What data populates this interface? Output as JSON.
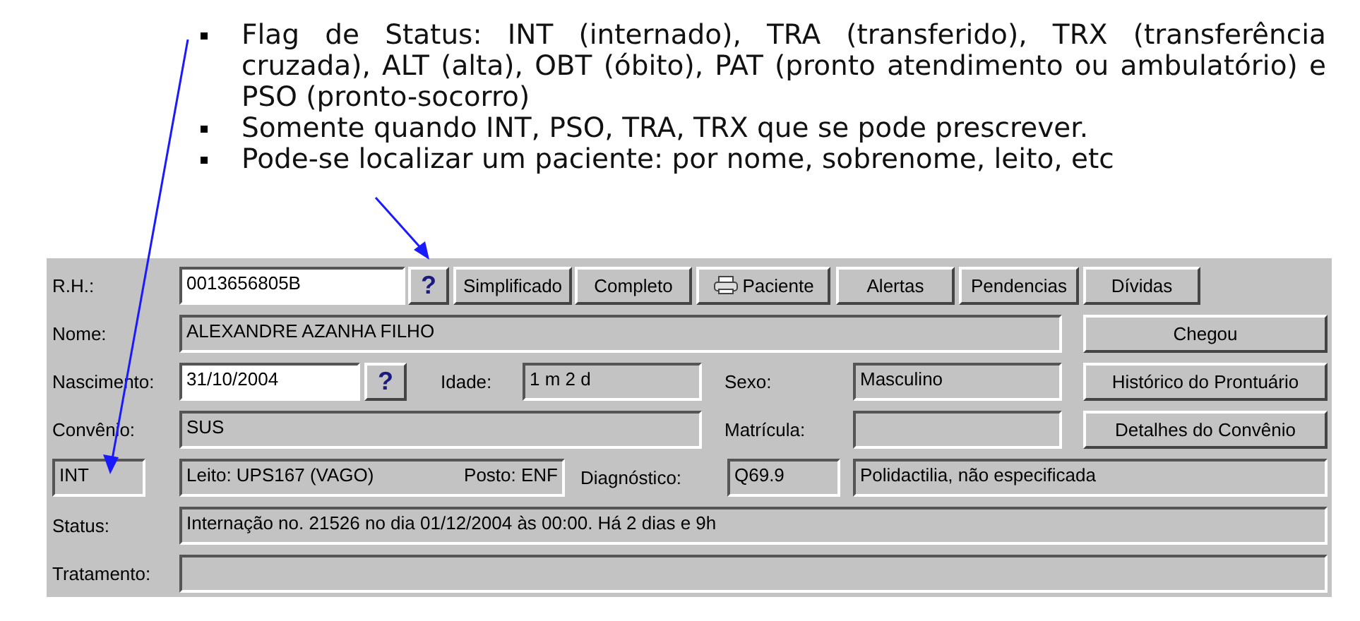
{
  "bullets": [
    "Flag de Status: INT (internado), TRA (transferido), TRX (transferência cruzada), ALT (alta), OBT (óbito), PAT (pronto atendimento ou ambulatório) e PSO (pronto-socorro)",
    "Somente quando INT, PSO, TRA, TRX que se pode prescrever.",
    "Pode-se localizar um paciente: por nome, sobrenome, leito, etc"
  ],
  "form": {
    "rows": [
      {
        "items": [
          {
            "kind": "label",
            "text": "R.H.:"
          },
          {
            "kind": "input",
            "text": "0013656805B"
          },
          {
            "kind": "lookup",
            "text": "?"
          },
          {
            "kind": "button",
            "text": "Simplificado"
          },
          {
            "kind": "button",
            "text": "Completo"
          },
          {
            "kind": "print-button",
            "text": "Paciente"
          },
          {
            "kind": "button",
            "text": "Alertas"
          },
          {
            "kind": "button",
            "text": "Pendencias"
          },
          {
            "kind": "button",
            "text": "Dívidas"
          }
        ]
      },
      {
        "items": [
          {
            "kind": "label",
            "text": "Nome:"
          },
          {
            "kind": "readonly",
            "text": "ALEXANDRE AZANHA FILHO"
          },
          {
            "kind": "button",
            "text": "Chegou"
          }
        ]
      },
      {
        "items": [
          {
            "kind": "label",
            "text": "Nascimento:"
          },
          {
            "kind": "input",
            "text": "31/10/2004"
          },
          {
            "kind": "lookup",
            "text": "?"
          },
          {
            "kind": "label",
            "text": "Idade:"
          },
          {
            "kind": "readonly",
            "text": "1 m 2 d"
          },
          {
            "kind": "label",
            "text": "Sexo:"
          },
          {
            "kind": "readonly",
            "text": "Masculino"
          },
          {
            "kind": "button",
            "text": "Histórico do Prontuário"
          }
        ]
      },
      {
        "items": [
          {
            "kind": "label",
            "text": "Convênio:"
          },
          {
            "kind": "readonly",
            "text": "SUS"
          },
          {
            "kind": "label",
            "text": "Matrícula:"
          },
          {
            "kind": "readonly"
          },
          {
            "kind": "button",
            "text": "Detalhes do Convênio"
          }
        ]
      },
      {
        "items": [
          {
            "kind": "readonly",
            "text": "INT"
          },
          {
            "kind": "pair",
            "text": "Leito: UPS167 (VAGO)",
            "extra": "Posto: ENF"
          },
          {
            "kind": "label",
            "text": "Diagnóstico:"
          },
          {
            "kind": "readonly",
            "text": "Q69.9"
          },
          {
            "kind": "readonly",
            "text": "Polidactilia, não especificada"
          }
        ]
      },
      {
        "items": [
          {
            "kind": "label",
            "text": "Status:"
          },
          {
            "kind": "readonly",
            "text": "Internação no. 21526 no dia 01/12/2004  às  00:00. Há 2 dias e 9h"
          }
        ]
      },
      {
        "items": [
          {
            "kind": "label",
            "text": "Tratamento:"
          },
          {
            "kind": "readonly"
          }
        ]
      }
    ]
  }
}
